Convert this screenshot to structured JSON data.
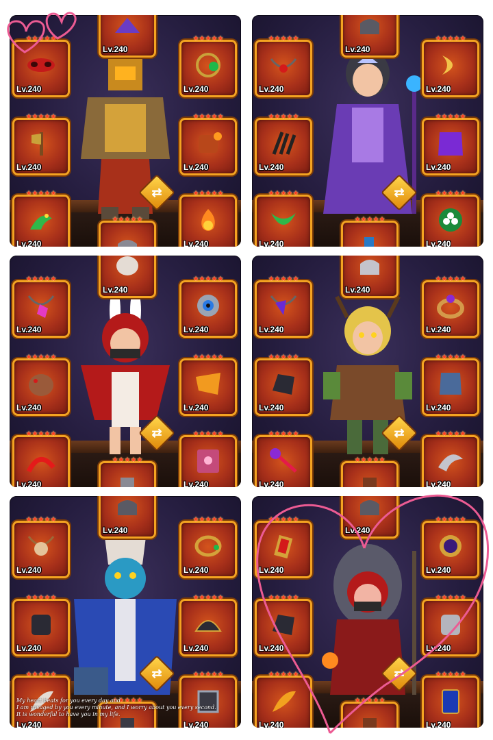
{
  "level_label": "Lv.240",
  "star_glyph": "★★★★★",
  "swap_glyph": "⇄",
  "colors": {
    "slot_border": "#f4a321",
    "slot_fill": "#c0401a",
    "star": "#ff3b1f",
    "heart": "#ec5b93",
    "panel_bg": "#251d3f"
  },
  "panels": [
    {
      "hero": "armored-knight",
      "slots": [
        "mask-icon",
        "wheel-hat-icon",
        "amulet-icon",
        "axe-icon",
        "gauntlet-icon",
        "serpent-icon",
        "flame-icon",
        "helmet-icon"
      ]
    },
    {
      "hero": "purple-mage",
      "slots": [
        "necklace-icon",
        "helmet-icon",
        "crescent-icon",
        "claw-icon",
        "cape-icon",
        "bow-icon",
        "clover-icon",
        "boot-icon"
      ]
    },
    {
      "hero": "red-hood-assassin",
      "slots": [
        "necklace-icon",
        "mask-icon",
        "eye-ring-icon",
        "cloak-icon",
        "cloth-icon",
        "claw-icon",
        "book-icon",
        "helmet-icon"
      ]
    },
    {
      "hero": "elf-ranger",
      "slots": [
        "necklace-icon",
        "helmet-icon",
        "ring-icon",
        "gauntlet-icon",
        "armor-icon",
        "staff-icon",
        "blade-icon",
        "boot-icon"
      ]
    },
    {
      "hero": "skull-shaman",
      "slots": [
        "bead-necklace-icon",
        "helmet-icon",
        "ring-icon",
        "gauntlet-icon",
        "shoulder-icon",
        "feather-icon",
        "frame-icon",
        "boot-icon"
      ]
    },
    {
      "hero": "fire-witch",
      "slots": [
        "pendant-icon",
        "helmet-icon",
        "orb-ring-icon",
        "gauntlet-icon",
        "armor-icon",
        "feather-icon",
        "card-icon",
        "boot-icon"
      ]
    }
  ],
  "caption": {
    "line1": "My heart beats for you every day and",
    "line2": "I am ravaged by you every minute, and I worry about you every second.",
    "line3": "It is wonderful to have you in my life."
  }
}
